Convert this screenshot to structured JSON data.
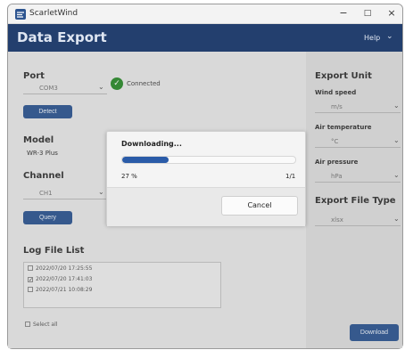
{
  "window": {
    "title": "ScarletWind",
    "controls": {
      "minimize": "−",
      "maximize": "□",
      "close": "×"
    }
  },
  "header": {
    "title": "Data Export",
    "help": "Help",
    "help_chevron": "⌄"
  },
  "left": {
    "port": {
      "label": "Port",
      "value": "COM3",
      "detect": "Detect",
      "status": "Connected"
    },
    "model": {
      "label": "Model",
      "value": "WR-3 Plus"
    },
    "channel": {
      "label": "Channel",
      "value": "CH1",
      "query": "Query"
    },
    "log": {
      "label": "Log File List",
      "items": [
        {
          "text": "2022/07/20 17:25:55",
          "checked": false
        },
        {
          "text": "2022/07/20 17:41:03",
          "checked": true
        },
        {
          "text": "2022/07/21 10:08:29",
          "checked": false
        }
      ],
      "select_all": "Select all"
    }
  },
  "right": {
    "export_unit": "Export Unit",
    "wind_speed": {
      "label": "Wind speed",
      "value": "m/s"
    },
    "air_temperature": {
      "label": "Air temperature",
      "value": "°C"
    },
    "air_pressure": {
      "label": "Air pressure",
      "value": "hPa"
    },
    "export_file_type": {
      "label": "Export File Type",
      "value": "xlsx"
    },
    "download": "Download"
  },
  "dialog": {
    "title": "Downloading...",
    "progress_percent_label": "27 %",
    "progress_fraction": 0.27,
    "count": "1/1",
    "cancel": "Cancel"
  },
  "colors": {
    "header": "#233f6e",
    "accent": "#2d5590",
    "progress": "#2a5ba8",
    "status_ok": "#2c8a2c"
  }
}
